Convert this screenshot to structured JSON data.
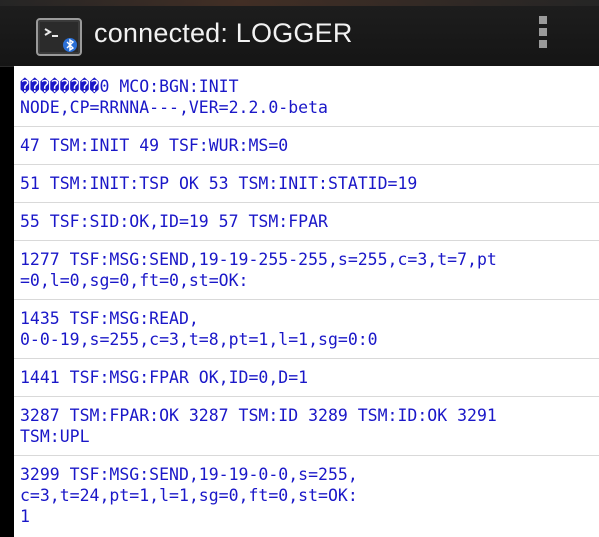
{
  "action_bar": {
    "title": "connected: LOGGER",
    "app_icon": "terminal-bluetooth-icon",
    "overflow_icon": "overflow-menu-icon"
  },
  "log": {
    "lines": [
      "��������0 MCO:BGN:INIT\nNODE,CP=RRNNA---,VER=2.2.0-beta",
      "47 TSM:INIT 49 TSF:WUR:MS=0",
      "51 TSM:INIT:TSP OK 53 TSM:INIT:STATID=19",
      "55 TSF:SID:OK,ID=19 57 TSM:FPAR",
      "1277 TSF:MSG:SEND,19-19-255-255,s=255,c=3,t=7,pt\n=0,l=0,sg=0,ft=0,st=OK:",
      "1435 TSF:MSG:READ,\n0-0-19,s=255,c=3,t=8,pt=1,l=1,sg=0:0",
      "1441 TSF:MSG:FPAR OK,ID=0,D=1",
      "3287 TSM:FPAR:OK 3287 TSM:ID 3289 TSM:ID:OK 3291\nTSM:UPL",
      "3299 TSF:MSG:SEND,19-19-0-0,s=255,\nc=3,t=24,pt=1,l=1,sg=0,ft=0,st=OK:\n1"
    ]
  },
  "colors": {
    "log_text": "#1a17c8",
    "action_bar": "#1e1e1e",
    "title_text": "#f2f2f2"
  }
}
